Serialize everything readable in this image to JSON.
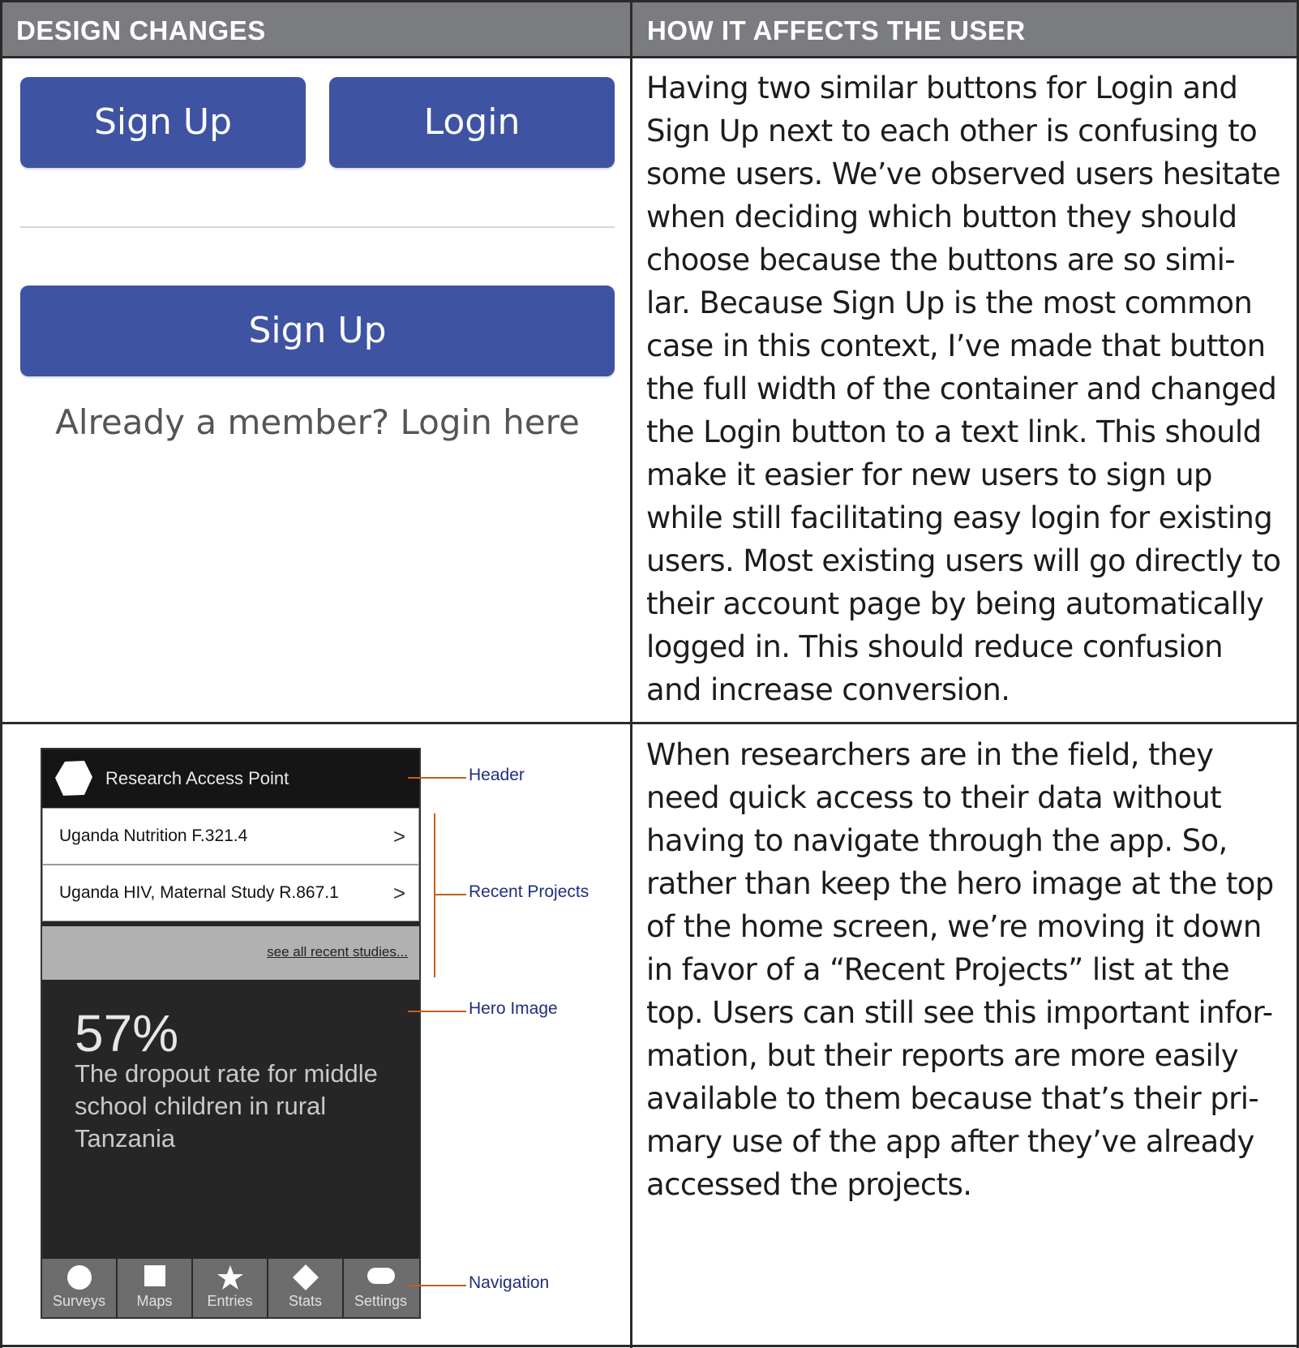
{
  "headers": {
    "design_changes": "DESIGN CHANGES",
    "how_it_affects": "HOW IT AFFECTS THE USER"
  },
  "row1": {
    "before_signup": "Sign Up",
    "before_login": "Login",
    "after_signup": "Sign Up",
    "after_login_link": "Already a member? Login here",
    "text_lines": [
      "Having two similar buttons for Login and",
      "Sign Up next to each other is confusing to",
      "some users. We’ve observed users hesitate",
      "when deciding which button they should",
      "choose because the buttons are so simi-",
      "lar. Because Sign Up is the most common",
      "case in this context, I’ve made that button",
      "the full width of the container and changed",
      "the Login button to a text link. This should",
      "make it easier for new users to sign up",
      "while still facilitating easy login for existing",
      "users. Most existing users will go directly to",
      "their account page by being automatically",
      "logged in. This should reduce confusion",
      "and increase conversion."
    ]
  },
  "row2": {
    "app_title": "Research Access Point",
    "projects": [
      {
        "label": "Uganda Nutrition F.321.4"
      },
      {
        "label": "Uganda HIV, Maternal Study R.867.1"
      }
    ],
    "see_all": "see all recent studies...",
    "hero_number": "57%",
    "hero_text": "The dropout rate for middle school children in rural Tanzania",
    "nav": [
      "Surveys",
      "Maps",
      "Entries",
      "Stats",
      "Settings"
    ],
    "callouts": {
      "header": "Header",
      "recent_projects": "Recent Projects",
      "hero_image": "Hero Image",
      "navigation": "Navigation"
    },
    "text_lines": [
      "When researchers are in the field, they",
      "need quick access to their data without",
      "having to navigate through the app. So,",
      "rather than keep the hero image at the top",
      "of the home screen, we’re moving it down",
      "in favor of a “Recent Projects” list at the",
      "top. Users can still see this important infor-",
      "mation, but their reports are more easily",
      "available to them because that’s their pri-",
      "mary use of the app after they’ve already",
      "accessed the projects."
    ]
  },
  "colors": {
    "header_bg": "#7b7c7f",
    "button_blue": "#3f53a3",
    "callout_orange": "#c45f1c",
    "callout_label": "#1f2f7d"
  }
}
